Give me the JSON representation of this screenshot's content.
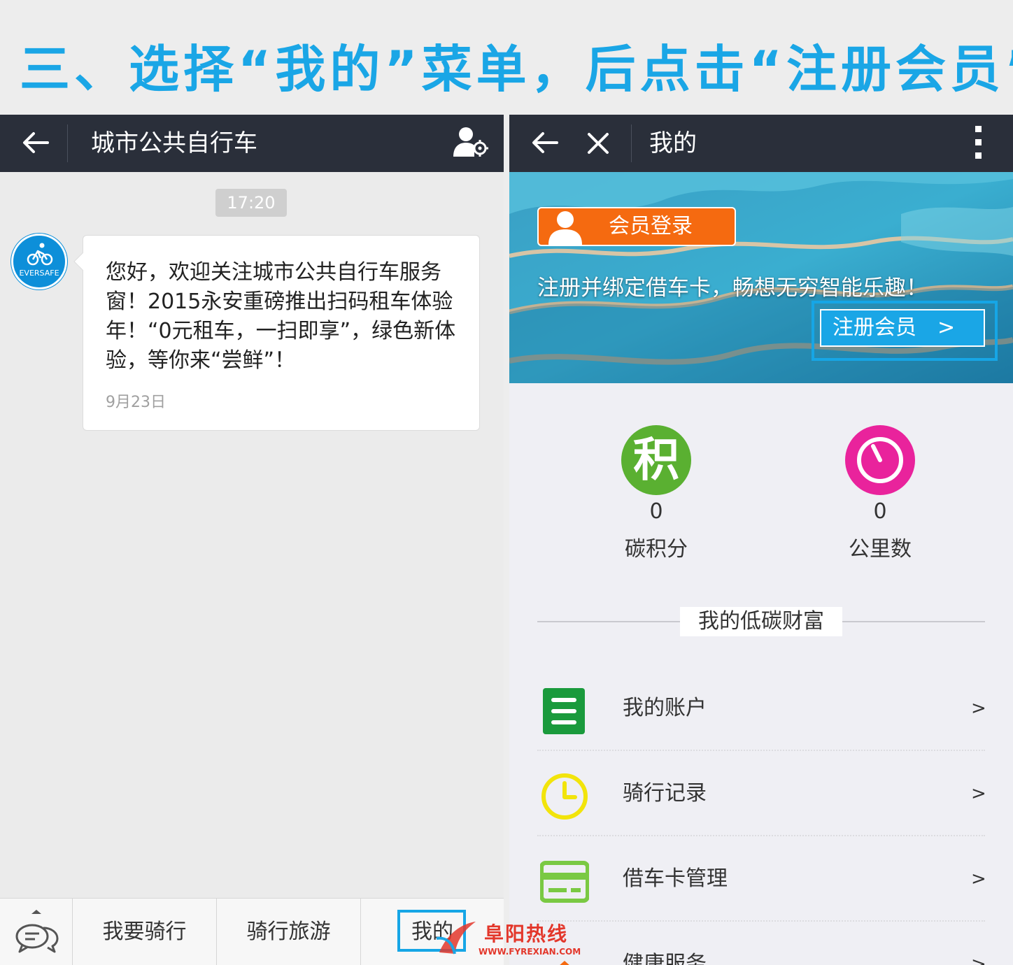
{
  "heading": {
    "text": "三、选择“我的”菜单，后点击“注册会员”。"
  },
  "left": {
    "nav_title": "城市公共自行车",
    "time_badge": "17:20",
    "avatar_text": "EVERSAFE",
    "message": {
      "text": "您好，欢迎关注城市公共自行车服务窗！2015永安重磅推出扫码租车体验年！“0元租车，一扫即享”，绿色新体验，等你来“尝鲜”！",
      "date": "9月23日"
    },
    "menu": [
      {
        "label": "我要骑行"
      },
      {
        "label": "骑行旅游"
      },
      {
        "label": "我的"
      }
    ]
  },
  "right": {
    "nav_title": "我的",
    "hero": {
      "login_label": "会员登录",
      "tagline": "注册并绑定借车卡，畅想无穷智能乐趣！",
      "register_label": "注册会员　>"
    },
    "stats": [
      {
        "glyph": "积",
        "value": "0",
        "label": "碳积分",
        "color": "#5ab031"
      },
      {
        "value": "0",
        "label": "公里数",
        "color": "#e9239c"
      }
    ],
    "section_title": "我的低碳财富",
    "rows": [
      {
        "label": "我的账户",
        "arrow": ">",
        "icon": "list-icon",
        "color": "#1a9a3c"
      },
      {
        "label": "骑行记录",
        "arrow": ">",
        "icon": "clock-icon",
        "color": "#f2e40b"
      },
      {
        "label": "借车卡管理",
        "arrow": ">",
        "icon": "card-icon",
        "color": "#7ac943"
      },
      {
        "label": "健康服务",
        "arrow": ">",
        "icon": "health-icon",
        "color": "#f56a10"
      }
    ]
  },
  "watermark": {
    "name": "阜阳热线",
    "url": "WWW.FYREXIAN.COM"
  },
  "colors": {
    "accent": "#16a6e6",
    "navbar": "#2a2f3a",
    "login_orange": "#f56a10"
  }
}
